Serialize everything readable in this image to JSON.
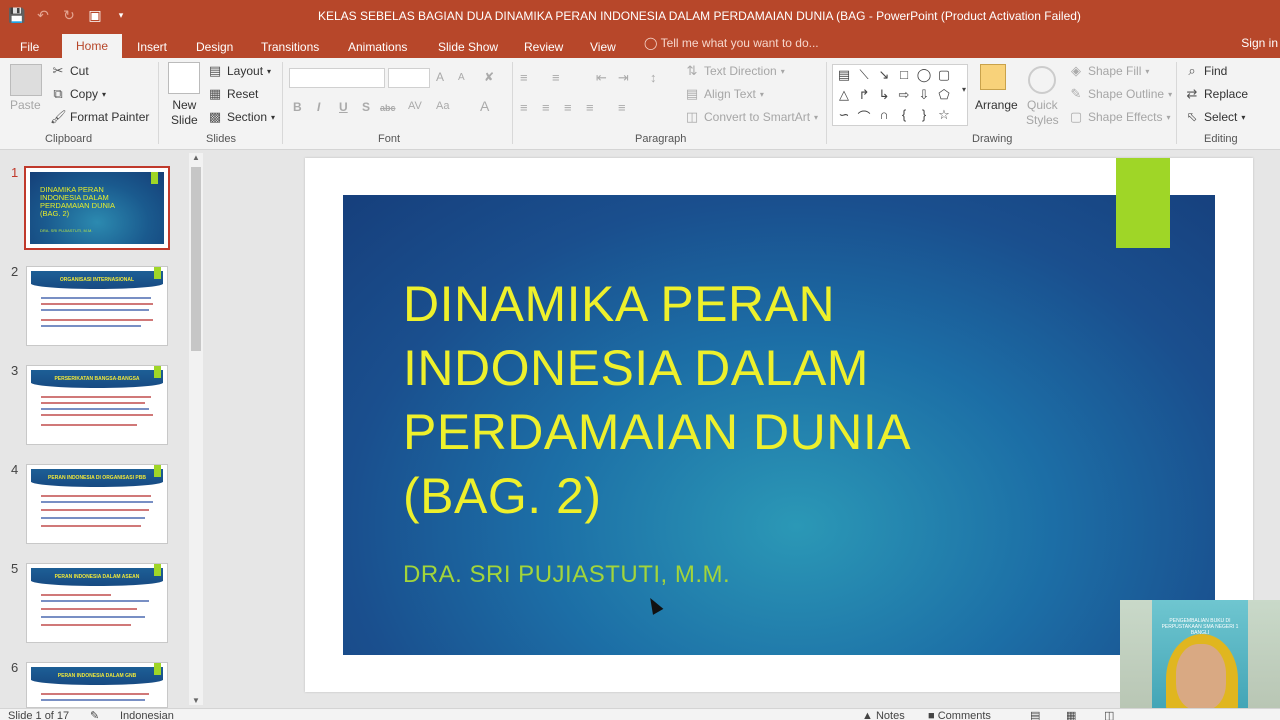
{
  "window": {
    "title": "KELAS SEBELAS BAGIAN DUA DINAMIKA PERAN INDONESIA DALAM PERDAMAIAN DUNIA (BAG - PowerPoint (Product Activation Failed)",
    "qat": [
      "save-icon",
      "undo-icon",
      "redo-icon",
      "present-icon",
      "customize-icon"
    ]
  },
  "tabs": [
    "File",
    "Home",
    "Insert",
    "Design",
    "Transitions",
    "Animations",
    "Slide Show",
    "Review",
    "View"
  ],
  "tellme": "Tell me what you want to do...",
  "signin": "Sign in",
  "ribbon": {
    "clipboard": {
      "paste": "Paste",
      "cut": "Cut",
      "copy": "Copy",
      "format_painter": "Format Painter",
      "label": "Clipboard"
    },
    "slides": {
      "new_slide_line1": "New",
      "new_slide_line2": "Slide",
      "layout": "Layout",
      "reset": "Reset",
      "section": "Section",
      "label": "Slides"
    },
    "font": {
      "label": "Font",
      "bold": "B",
      "italic": "I",
      "underline": "U",
      "strike": "S",
      "shadow": "abc",
      "grow": "A",
      "shrink": "A"
    },
    "paragraph": {
      "label": "Paragraph",
      "text_direction": "Text Direction",
      "align_text": "Align Text",
      "convert_smartart": "Convert to SmartArt"
    },
    "drawing": {
      "label": "Drawing",
      "arrange": "Arrange",
      "quick_styles_line1": "Quick",
      "quick_styles_line2": "Styles",
      "shape_fill": "Shape Fill",
      "shape_outline": "Shape Outline",
      "shape_effects": "Shape Effects"
    },
    "editing": {
      "label": "Editing",
      "find": "Find",
      "replace": "Replace",
      "select": "Select"
    }
  },
  "thumbnails": [
    {
      "num": "1",
      "title": "DINAMIKA PERAN INDONESIA DALAM PERDAMAIAN DUNIA (BAG. 2)",
      "sub": "DRA. SRI PUJIASTUTI, M.M."
    },
    {
      "num": "2",
      "banner": "ORGANISASI INTERNASIONAL"
    },
    {
      "num": "3",
      "banner": "PERSERIKATAN BANGSA-BANGSA"
    },
    {
      "num": "4",
      "banner": "PERAN INDONESIA DI ORGANISASI PBB"
    },
    {
      "num": "5",
      "banner": "PERAN INDONESIA DALAM ASEAN"
    },
    {
      "num": "6",
      "banner": "PERAN INDONESIA DALAM GNB"
    }
  ],
  "slide": {
    "title_lines": [
      "DINAMIKA PERAN",
      "INDONESIA DALAM",
      "PERDAMAIAN DUNIA",
      "(BAG. 2)"
    ],
    "subtitle": "DRA. SRI PUJIASTUTI, M.M."
  },
  "webcam": {
    "poster_text": "PENGEMBALIAN BUKU DI PERPUSTAKAAN SMA NEGERI 1 BANGLI"
  },
  "status": {
    "slide_of": "Slide 1 of 17",
    "language": "Indonesian",
    "notes": "Notes",
    "comments": "Comments"
  },
  "colors": {
    "accent": "#b7472a",
    "slide_title": "#eef02c",
    "slide_sub": "#a3d53a",
    "slide_green": "#9fd627"
  }
}
